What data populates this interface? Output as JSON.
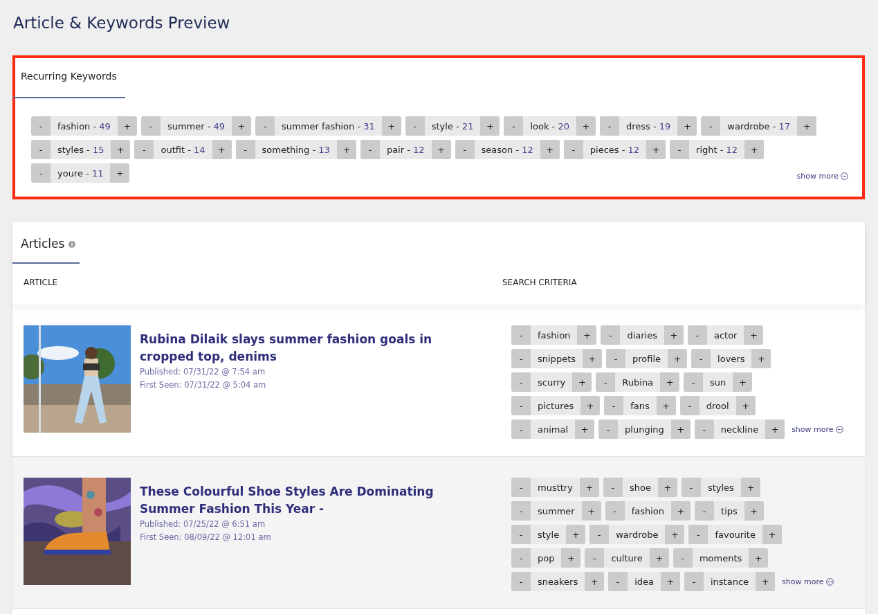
{
  "page_title": "Article & Keywords Preview",
  "recurring_keywords": {
    "tab": "Recurring Keywords",
    "highlighted": true,
    "rows": [
      [
        {
          "minus": "-",
          "label": "fashion -",
          "count": "49",
          "plus": "+"
        },
        {
          "minus": "-",
          "label": "summer -",
          "count": "49",
          "plus": "+"
        },
        {
          "minus": "-",
          "label": "summer fashion -",
          "count": "31",
          "plus": "+"
        },
        {
          "minus": "-",
          "label": "style -",
          "count": "21",
          "plus": "+"
        },
        {
          "minus": "-",
          "label": "look -",
          "count": "20",
          "plus": "+"
        },
        {
          "minus": "-",
          "label": "dress -",
          "count": "19",
          "plus": "+"
        },
        {
          "minus": "-",
          "label": "wardrobe -",
          "count": "17",
          "plus": "+"
        }
      ],
      [
        {
          "minus": "-",
          "label": "styles -",
          "count": "15",
          "plus": "+"
        },
        {
          "minus": "-",
          "label": "outfit -",
          "count": "14",
          "plus": "+"
        },
        {
          "minus": "-",
          "label": "something -",
          "count": "13",
          "plus": "+"
        },
        {
          "minus": "-",
          "label": "pair -",
          "count": "12",
          "plus": "+"
        },
        {
          "minus": "-",
          "label": "season -",
          "count": "12",
          "plus": "+"
        },
        {
          "minus": "-",
          "label": "pieces -",
          "count": "12",
          "plus": "+"
        },
        {
          "minus": "-",
          "label": "right -",
          "count": "12",
          "plus": "+"
        }
      ],
      [
        {
          "minus": "-",
          "label": "youre -",
          "count": "11",
          "plus": "+"
        }
      ]
    ],
    "show_more": "show more"
  },
  "articles": {
    "tab": "Articles",
    "columns": [
      "ARTICLE",
      "SEARCH CRITERIA"
    ],
    "rows": [
      {
        "kind": "picture",
        "title": "Rubina Dilaik slays summer fashion goals in cropped top, denims",
        "published": "Published: 07/31/22 @ 7:54 am",
        "first_seen": "First Seen: 07/31/22 @ 5:04 am",
        "keyword_rows": [
          [
            {
              "minus": "-",
              "keyword": "fashion",
              "plus": "+"
            },
            {
              "minus": "-",
              "keyword": "diaries",
              "plus": "+"
            },
            {
              "minus": "-",
              "keyword": "actor",
              "plus": "+"
            }
          ],
          [
            {
              "minus": "-",
              "keyword": "snippets",
              "plus": "+"
            },
            {
              "minus": "-",
              "keyword": "profile",
              "plus": "+"
            },
            {
              "minus": "-",
              "keyword": "lovers",
              "plus": "+"
            }
          ],
          [
            {
              "minus": "-",
              "keyword": "scurry",
              "plus": "+"
            },
            {
              "minus": "-",
              "keyword": "Rubina",
              "plus": "+"
            },
            {
              "minus": "-",
              "keyword": "sun",
              "plus": "+"
            }
          ],
          [
            {
              "minus": "-",
              "keyword": "pictures",
              "plus": "+"
            },
            {
              "minus": "-",
              "keyword": "fans",
              "plus": "+"
            },
            {
              "minus": "-",
              "keyword": "drool",
              "plus": "+"
            }
          ],
          [
            {
              "minus": "-",
              "keyword": "animal",
              "plus": "+"
            },
            {
              "minus": "-",
              "keyword": "plunging",
              "plus": "+"
            },
            {
              "minus": "-",
              "keyword": "neckline",
              "plus": "+"
            }
          ]
        ],
        "show_more": "show more"
      },
      {
        "kind": "picture",
        "title": "These Colourful Shoe Styles Are Dominating Summer Fashion This Year -",
        "published": "Published: 07/25/22 @ 6:51 am",
        "first_seen": "First Seen: 08/09/22 @ 12:01 am",
        "keyword_rows": [
          [
            {
              "minus": "-",
              "keyword": "musttry",
              "plus": "+"
            },
            {
              "minus": "-",
              "keyword": "shoe",
              "plus": "+"
            },
            {
              "minus": "-",
              "keyword": "styles",
              "plus": "+"
            }
          ],
          [
            {
              "minus": "-",
              "keyword": "summer",
              "plus": "+"
            },
            {
              "minus": "-",
              "keyword": "fashion",
              "plus": "+"
            },
            {
              "minus": "-",
              "keyword": "tips",
              "plus": "+"
            }
          ],
          [
            {
              "minus": "-",
              "keyword": "style",
              "plus": "+"
            },
            {
              "minus": "-",
              "keyword": "wardrobe",
              "plus": "+"
            },
            {
              "minus": "-",
              "keyword": "favourite",
              "plus": "+"
            }
          ],
          [
            {
              "minus": "-",
              "keyword": "pop",
              "plus": "+"
            },
            {
              "minus": "-",
              "keyword": "culture",
              "plus": "+"
            },
            {
              "minus": "-",
              "keyword": "moments",
              "plus": "+"
            }
          ],
          [
            {
              "minus": "-",
              "keyword": "sneakers",
              "plus": "+"
            },
            {
              "minus": "-",
              "keyword": "idea",
              "plus": "+"
            },
            {
              "minus": "-",
              "keyword": "instance",
              "plus": "+"
            }
          ]
        ],
        "show_more": "show more"
      }
    ]
  }
}
